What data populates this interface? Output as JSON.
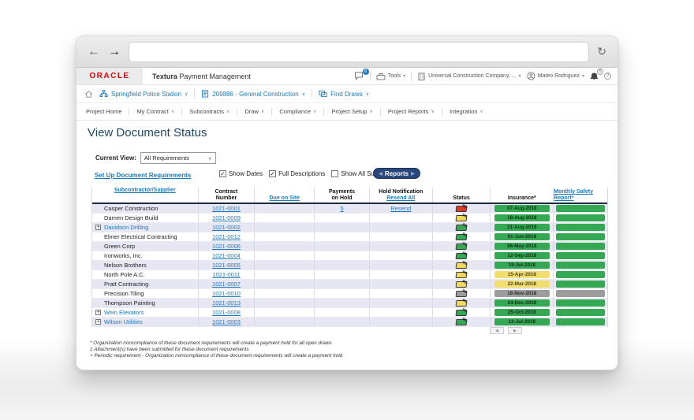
{
  "icons": {
    "back": "←",
    "forward": "→",
    "reload": "↻",
    "caret_down": "∨",
    "select_caret": "▾",
    "pen": "✎",
    "expander": "+",
    "check": "✓",
    "prev": "◀",
    "next": "▶",
    "help": "?",
    "reports_tip_left": "◀",
    "reports_tip_right": "▶"
  },
  "browser": {
    "url": ""
  },
  "app_header": {
    "brand": "ORACLE",
    "product_bold": "Textura",
    "product_rest": " Payment Management",
    "messages_badge": "6",
    "tools_label": "Tools",
    "company_label": "Universal Construction Company, ...",
    "user_label": "Mateo Rodriguez",
    "bell_badge": "0"
  },
  "breadcrumb": {
    "items": [
      {
        "label": "Springfield Police Station"
      },
      {
        "label": "209886 - General Construction"
      },
      {
        "label": "Find Draws"
      }
    ]
  },
  "nav": {
    "items": [
      {
        "label": "Project Home",
        "caret": false
      },
      {
        "label": "My Contract",
        "caret": true
      },
      {
        "label": "Subcontracts",
        "caret": true
      },
      {
        "label": "Draw",
        "caret": true
      },
      {
        "label": "Compliance",
        "caret": true
      },
      {
        "label": "Project Setup",
        "caret": true
      },
      {
        "label": "Project Reports",
        "caret": true
      },
      {
        "label": "Integration",
        "caret": true
      }
    ]
  },
  "page": {
    "title": "View Document Status"
  },
  "controls": {
    "current_view_label": "Current View:",
    "current_view_value": "All Requirements",
    "setup_link": "Set Up Document Requirements",
    "checkboxes": [
      {
        "label": "Show Dates",
        "checked": true
      },
      {
        "label": "Full Descriptions",
        "checked": true
      },
      {
        "label": "Show All Sub Tiers",
        "checked": false
      }
    ],
    "reports_button": "Reports"
  },
  "table": {
    "columns": [
      {
        "key": "subcontractor",
        "lines": [
          {
            "text": "Subcontractor/Supplier",
            "link": true
          }
        ]
      },
      {
        "key": "contract-number",
        "lines": [
          {
            "text": "Contract",
            "link": false
          },
          {
            "text": "Number",
            "link": false
          }
        ]
      },
      {
        "key": "due-on-site",
        "lines": [
          {
            "text": "Due on Site",
            "link": true
          }
        ]
      },
      {
        "key": "payments-on-hold",
        "lines": [
          {
            "text": "Payments",
            "link": false
          },
          {
            "text": "on Hold",
            "link": false
          }
        ]
      },
      {
        "key": "hold-notification",
        "lines": [
          {
            "text": "Hold Notification",
            "link": false
          },
          {
            "text": "Resend All",
            "link": true
          }
        ]
      },
      {
        "key": "status",
        "lines": [
          {
            "text": "Status",
            "link": false
          }
        ]
      },
      {
        "key": "insurance",
        "lines": [
          {
            "text": "Insurance*",
            "link": false
          }
        ]
      },
      {
        "key": "safety-report",
        "lines": [
          {
            "text": "Monthly Safety Report*",
            "link": true
          }
        ]
      }
    ],
    "rows": [
      {
        "expander": false,
        "link": false,
        "name": "Casper Construction",
        "contract": "1021-0001",
        "due": "",
        "payments": "5",
        "hold": "Resend",
        "status": "red",
        "insurance": "07-Aug-2018",
        "insurance_color": "green",
        "safety": "green"
      },
      {
        "expander": false,
        "link": false,
        "name": "Damen Design Build",
        "contract": "1021-0009",
        "due": "",
        "payments": "",
        "hold": "",
        "status": "yellow",
        "insurance": "18-Aug-2018",
        "insurance_color": "green",
        "safety": "green"
      },
      {
        "expander": true,
        "link": true,
        "name": "Davidson Drilling",
        "contract": "1021-0002",
        "due": "",
        "payments": "",
        "hold": "",
        "status": "green",
        "insurance": "21-Aug-2018",
        "insurance_color": "green",
        "safety": "green"
      },
      {
        "expander": false,
        "link": false,
        "name": "Elmer Electrical Contracting",
        "contract": "1021-0012",
        "due": "",
        "payments": "",
        "hold": "",
        "status": "green",
        "insurance": "01-Jun-2018",
        "insurance_color": "green",
        "safety": "green"
      },
      {
        "expander": false,
        "link": false,
        "name": "Green Corp",
        "contract": "1021-0006",
        "due": "",
        "payments": "",
        "hold": "",
        "status": "green",
        "insurance": "06-May-2018",
        "insurance_color": "green",
        "safety": "green"
      },
      {
        "expander": false,
        "link": false,
        "name": "Ironworks, Inc.",
        "contract": "1021-0004",
        "due": "",
        "payments": "",
        "hold": "",
        "status": "green",
        "insurance": "12-Sep-2018",
        "insurance_color": "green",
        "safety": "green"
      },
      {
        "expander": false,
        "link": false,
        "name": "Nelson Brothers",
        "contract": "1021-0005",
        "due": "",
        "payments": "",
        "hold": "",
        "status": "yellow",
        "insurance": "19-Jul-2018",
        "insurance_color": "green",
        "safety": "green"
      },
      {
        "expander": false,
        "link": false,
        "name": "North Pole A.C.",
        "contract": "1021-0011",
        "due": "",
        "payments": "",
        "hold": "",
        "status": "yellow",
        "insurance": "15-Apr-2018",
        "insurance_color": "yellow",
        "safety": "green"
      },
      {
        "expander": false,
        "link": false,
        "name": "Pratt Contracting",
        "contract": "1021-0007",
        "due": "",
        "payments": "",
        "hold": "",
        "status": "yellow",
        "insurance": "22-Mar-2018",
        "insurance_color": "yellow",
        "safety": "green"
      },
      {
        "expander": false,
        "link": false,
        "name": "Precision Tiling",
        "contract": "1021-0010",
        "due": "",
        "payments": "",
        "hold": "",
        "status": "gray",
        "insurance": "16-Nov-2018",
        "insurance_color": "gray",
        "safety": "gray"
      },
      {
        "expander": false,
        "link": false,
        "name": "Thompson Painting",
        "contract": "1021-0013",
        "due": "",
        "payments": "",
        "hold": "",
        "status": "yellow",
        "insurance": "24-Dec-2018",
        "insurance_color": "green",
        "safety": "green"
      },
      {
        "expander": true,
        "link": true,
        "name": "Wein Elevators",
        "contract": "1021-0008",
        "due": "",
        "payments": "",
        "hold": "",
        "status": "green",
        "insurance": "25-Oct-2018",
        "insurance_color": "green",
        "safety": "green"
      },
      {
        "expander": true,
        "link": true,
        "name": "Wilson Utilities",
        "contract": "1021-0003",
        "due": "",
        "payments": "",
        "hold": "",
        "status": "green",
        "insurance": "13-Jul-2018",
        "insurance_color": "green",
        "safety": "green"
      }
    ]
  },
  "footnotes": [
    "* Organization noncompliance of these document requirements will create a payment hold for all open draws",
    "‡ Attachment(s) have been submitted for these document requirements",
    "+ Periodic requirement - Organization noncompliance of these document requirements will create a payment hold"
  ],
  "colors": {
    "green": "#35a854",
    "yellow": "#f1de6f",
    "red": "#dc3a2a",
    "gray": "#9c9c9c",
    "link": "#1b79c0",
    "button": "#28477c"
  }
}
